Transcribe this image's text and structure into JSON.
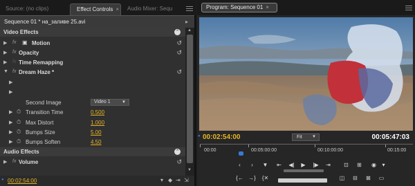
{
  "left_panel": {
    "tabs": {
      "source": "Source: (no clips)",
      "effect_controls": "Effect Controls",
      "close": "×",
      "audio_mixer": "Audio Mixer: Sequ"
    },
    "sequence_title": "Sequence 01 * на_заливе 25.avi",
    "video_effects_header": "Video Effects",
    "effects": {
      "motion": "Motion",
      "opacity": "Opacity",
      "time_remapping": "Time Remapping",
      "dream_haze": "Dream Haze *"
    },
    "fx_badge": "fx",
    "second_image_label": "Second Image",
    "second_image_value": "Video 1",
    "params": [
      {
        "label": "Transition Time",
        "value": "0.500"
      },
      {
        "label": "Max Distort",
        "value": "1.000"
      },
      {
        "label": "Bumps Size",
        "value": "5.00"
      },
      {
        "label": "Bumps Soften",
        "value": "4.50"
      }
    ],
    "audio_effects_header": "Audio Effects",
    "audio_volume": "Volume",
    "timecode": "00:02:54:00"
  },
  "right_panel": {
    "tab_title": "Program: Sequence 01",
    "tab_close": "×",
    "current_timecode": "00:02:54:00",
    "fit_label": "Fit",
    "duration_timecode": "00:05:47:03",
    "ruler_labels": [
      "00:00",
      "00:05:00:00",
      "00:10:00:00",
      "00:15:00"
    ]
  },
  "colors": {
    "accent_timecode": "#e6b526",
    "playhead": "#3a78d8"
  }
}
